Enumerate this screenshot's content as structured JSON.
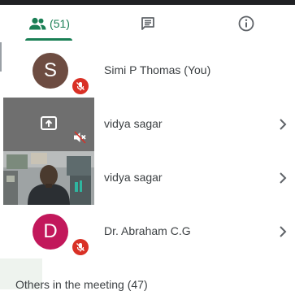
{
  "tabs": {
    "people": {
      "icon": "people-icon",
      "count": "(51)",
      "active": true
    },
    "chat": {
      "icon": "chat-icon"
    },
    "info": {
      "icon": "info-icon"
    }
  },
  "participants": [
    {
      "name": "Simi P Thomas (You)",
      "avatar_letter": "S",
      "avatar_color": "#6d4c41",
      "muted": true,
      "tile": "avatar"
    },
    {
      "name": "vidya sagar",
      "tile": "presentation",
      "muted": true
    },
    {
      "name": "vidya sagar",
      "tile": "video"
    },
    {
      "name": "Dr. Abraham C.G",
      "avatar_letter": "D",
      "avatar_color": "#c2185b",
      "muted": true,
      "tile": "avatar"
    }
  ],
  "others_section": {
    "label": "Others in the meeting (47)"
  },
  "colors": {
    "accent": "#1a7f55",
    "muted_badge": "#d93025"
  }
}
